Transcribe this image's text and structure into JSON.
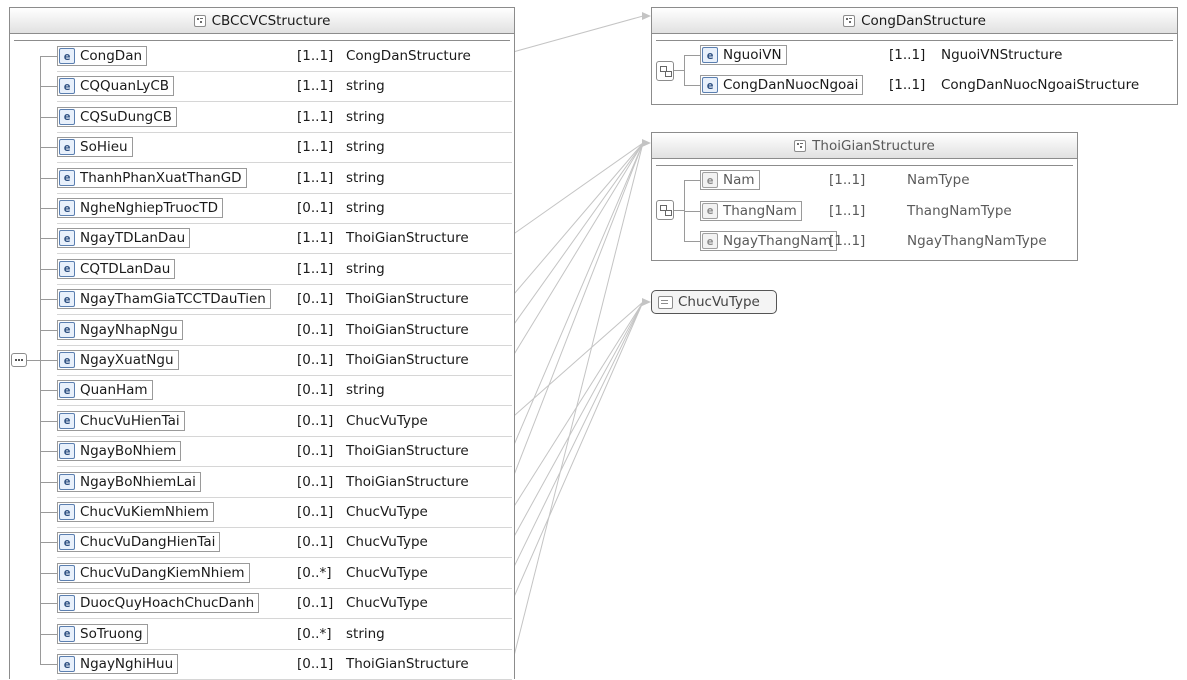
{
  "cbccvc": {
    "title": "CBCCVCStructure",
    "elements": [
      {
        "name": "CongDan",
        "card": "[1..1]",
        "type": "CongDanStructure"
      },
      {
        "name": "CQQuanLyCB",
        "card": "[1..1]",
        "type": "string"
      },
      {
        "name": "CQSuDungCB",
        "card": "[1..1]",
        "type": "string"
      },
      {
        "name": "SoHieu",
        "card": "[1..1]",
        "type": "string"
      },
      {
        "name": "ThanhPhanXuatThanGD",
        "card": "[1..1]",
        "type": "string"
      },
      {
        "name": "NgheNghiepTruocTD",
        "card": "[0..1]",
        "type": "string"
      },
      {
        "name": "NgayTDLanDau",
        "card": "[1..1]",
        "type": "ThoiGianStructure"
      },
      {
        "name": "CQTDLanDau",
        "card": "[1..1]",
        "type": "string"
      },
      {
        "name": "NgayThamGiaTCCTDauTien",
        "card": "[0..1]",
        "type": "ThoiGianStructure"
      },
      {
        "name": "NgayNhapNgu",
        "card": "[0..1]",
        "type": "ThoiGianStructure"
      },
      {
        "name": "NgayXuatNgu",
        "card": "[0..1]",
        "type": "ThoiGianStructure"
      },
      {
        "name": "QuanHam",
        "card": "[0..1]",
        "type": "string"
      },
      {
        "name": "ChucVuHienTai",
        "card": "[0..1]",
        "type": "ChucVuType"
      },
      {
        "name": "NgayBoNhiem",
        "card": "[0..1]",
        "type": "ThoiGianStructure"
      },
      {
        "name": "NgayBoNhiemLai",
        "card": "[0..1]",
        "type": "ThoiGianStructure"
      },
      {
        "name": "ChucVuKiemNhiem",
        "card": "[0..1]",
        "type": "ChucVuType"
      },
      {
        "name": "ChucVuDangHienTai",
        "card": "[0..1]",
        "type": "ChucVuType"
      },
      {
        "name": "ChucVuDangKiemNhiem",
        "card": "[0..*]",
        "type": "ChucVuType"
      },
      {
        "name": "DuocQuyHoachChucDanh",
        "card": "[0..1]",
        "type": "ChucVuType"
      },
      {
        "name": "SoTruong",
        "card": "[0..*]",
        "type": "string"
      },
      {
        "name": "NgayNghiHuu",
        "card": "[0..1]",
        "type": "ThoiGianStructure"
      }
    ]
  },
  "congdan": {
    "title": "CongDanStructure",
    "elements": [
      {
        "name": "NguoiVN",
        "card": "[1..1]",
        "type": "NguoiVNStructure"
      },
      {
        "name": "CongDanNuocNgoai",
        "card": "[1..1]",
        "type": "CongDanNuocNgoaiStructure"
      }
    ]
  },
  "thoigian": {
    "title": "ThoiGianStructure",
    "elements": [
      {
        "name": "Nam",
        "card": "[1..1]",
        "type": "NamType"
      },
      {
        "name": "ThangNam",
        "card": "[1..1]",
        "type": "ThangNamType"
      },
      {
        "name": "NgayThangNam",
        "card": "[1..1]",
        "type": "NgayThangNamType"
      }
    ]
  },
  "chucvu": {
    "title": "ChucVuType"
  },
  "icons": {
    "element_glyph": "e"
  }
}
